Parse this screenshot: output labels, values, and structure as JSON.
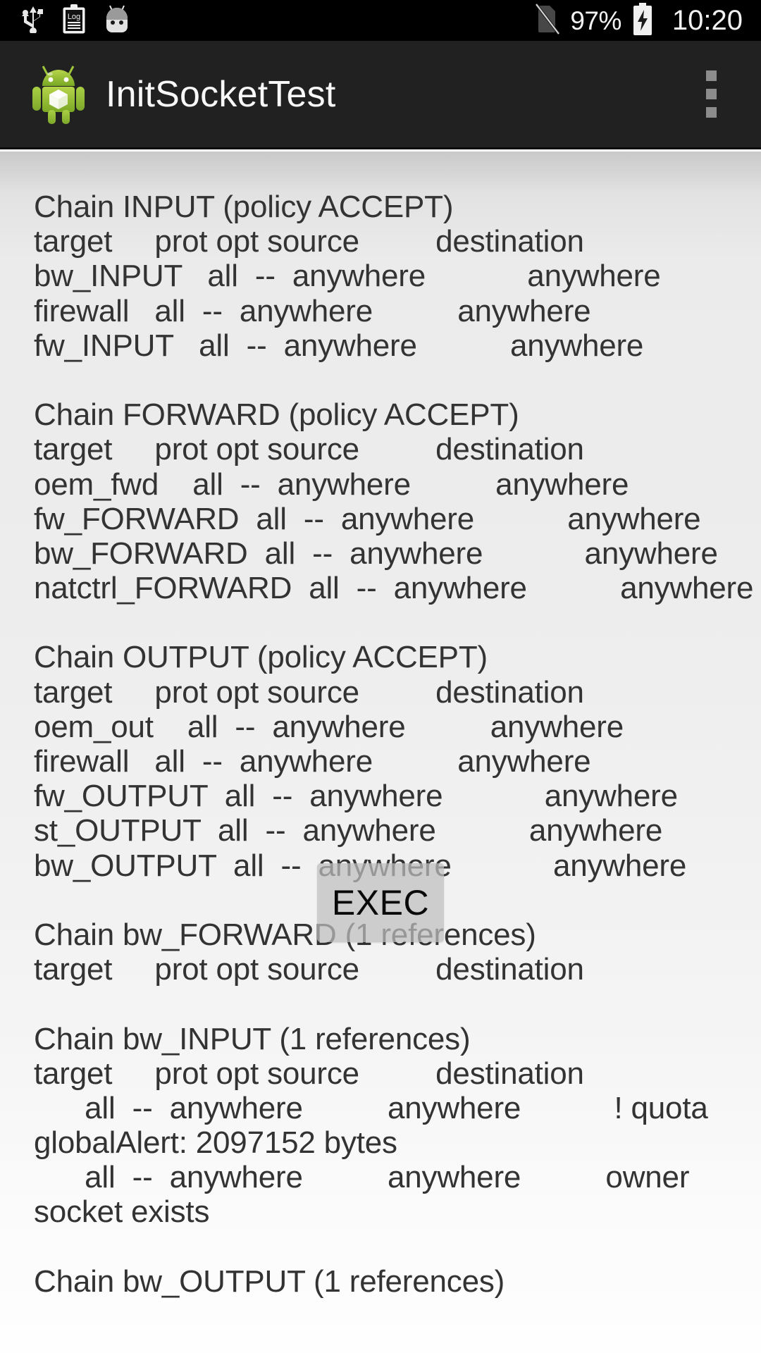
{
  "statusbar": {
    "icons": [
      {
        "name": "usb-icon"
      },
      {
        "name": "log-clipboard-icon",
        "label": "Log"
      },
      {
        "name": "android-head-icon"
      }
    ],
    "sim_icon": "no-sim-card-icon",
    "battery_percent": "97%",
    "battery_icon": "battery-charging-icon",
    "clock": "10:20"
  },
  "actionbar": {
    "app_icon": "android-app-icon",
    "title": "InitSocketTest",
    "overflow_icon": "overflow-menu-icon"
  },
  "exec_button": {
    "label": "EXEC"
  },
  "console": {
    "lines": [
      "Chain INPUT (policy ACCEPT)",
      "target     prot opt source         destination",
      "bw_INPUT   all  --  anywhere            anywhere",
      "firewall   all  --  anywhere          anywhere",
      "fw_INPUT   all  --  anywhere           anywhere",
      "",
      "Chain FORWARD (policy ACCEPT)",
      "target     prot opt source         destination",
      "oem_fwd    all  --  anywhere          anywhere",
      "fw_FORWARD  all  --  anywhere           anywhere",
      "bw_FORWARD  all  --  anywhere            anywhere",
      "natctrl_FORWARD  all  --  anywhere           anywhere",
      "",
      "Chain OUTPUT (policy ACCEPT)",
      "target     prot opt source         destination",
      "oem_out    all  --  anywhere          anywhere",
      "firewall   all  --  anywhere          anywhere",
      "fw_OUTPUT  all  --  anywhere            anywhere",
      "st_OUTPUT  all  --  anywhere           anywhere",
      "bw_OUTPUT  all  --  anywhere            anywhere",
      "",
      "Chain bw_FORWARD (1 references)",
      "target     prot opt source         destination",
      "",
      "Chain bw_INPUT (1 references)",
      "target     prot opt source         destination",
      "      all  --  anywhere          anywhere           ! quota",
      "globalAlert: 2097152 bytes",
      "      all  --  anywhere          anywhere          owner",
      "socket exists",
      "",
      "Chain bw_OUTPUT (1 references)"
    ]
  },
  "colors": {
    "statusbar_bg": "#000000",
    "actionbar_bg": "#212121",
    "actionbar_text": "#f8f8f8",
    "console_text": "#333333",
    "exec_bg": "#bebebe",
    "android_green": "#a4c739"
  }
}
